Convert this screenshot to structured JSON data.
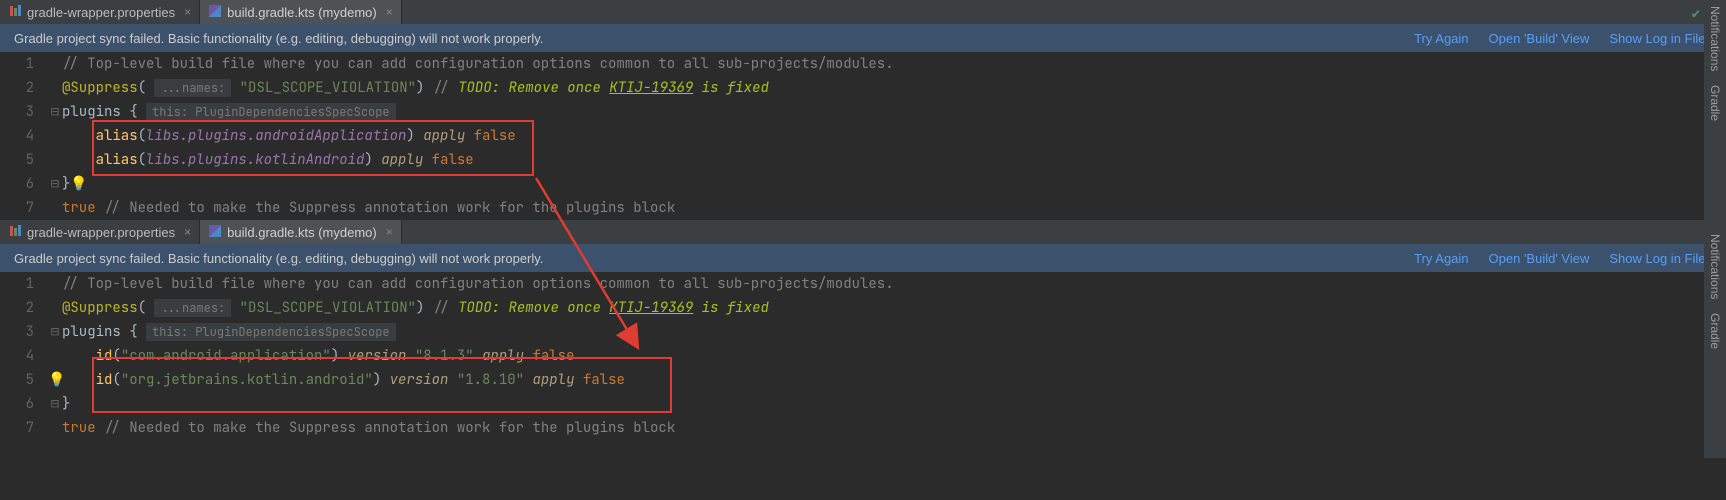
{
  "tabs": [
    {
      "label": "gradle-wrapper.properties"
    },
    {
      "label": "build.gradle.kts (mydemo)"
    }
  ],
  "notif": {
    "msg": "Gradle project sync failed. Basic functionality (e.g. editing, debugging) will not work properly.",
    "try": "Try Again",
    "open": "Open 'Build' View",
    "log": "Show Log in Files"
  },
  "hints": {
    "names": "...names:",
    "this": "this: PluginDependenciesSpecScope"
  },
  "code1": {
    "l1": "// Top-level build file where you can add configuration options common to all sub-projects/modules.",
    "l2a": "@Suppress",
    "l2b": "\"DSL_SCOPE_VIOLATION\"",
    "l2c": "// ",
    "l2d": "TODO: Remove once ",
    "l2e": "KTIJ-19369",
    "l2f": " is fixed",
    "l3": "plugins {",
    "l4a": "alias",
    "l4b": "libs.plugins.androidApplication",
    "l4c": "apply",
    "l4d": "false",
    "l5a": "alias",
    "l5b": "libs.plugins.kotlinAndroid",
    "l5c": "apply",
    "l5d": "false",
    "l6": "}",
    "l7a": "true",
    "l7b": "// Needed to make the Suppress annotation work for the plugins block"
  },
  "code2": {
    "l4a": "id",
    "l4b": "\"com.android.application\"",
    "l4c": "version",
    "l4d": "\"8.1.3\"",
    "l4e": "apply",
    "l4f": "false",
    "l5a": "id",
    "l5b": "\"org.jetbrains.kotlin.android\"",
    "l5c": "version",
    "l5d": "\"1.8.10\"",
    "l5e": "apply",
    "l5f": "false"
  },
  "sidebar": {
    "notif": "Notifications",
    "gradle": "Gradle"
  },
  "lines": [
    "1",
    "2",
    "3",
    "4",
    "5",
    "6",
    "7"
  ]
}
